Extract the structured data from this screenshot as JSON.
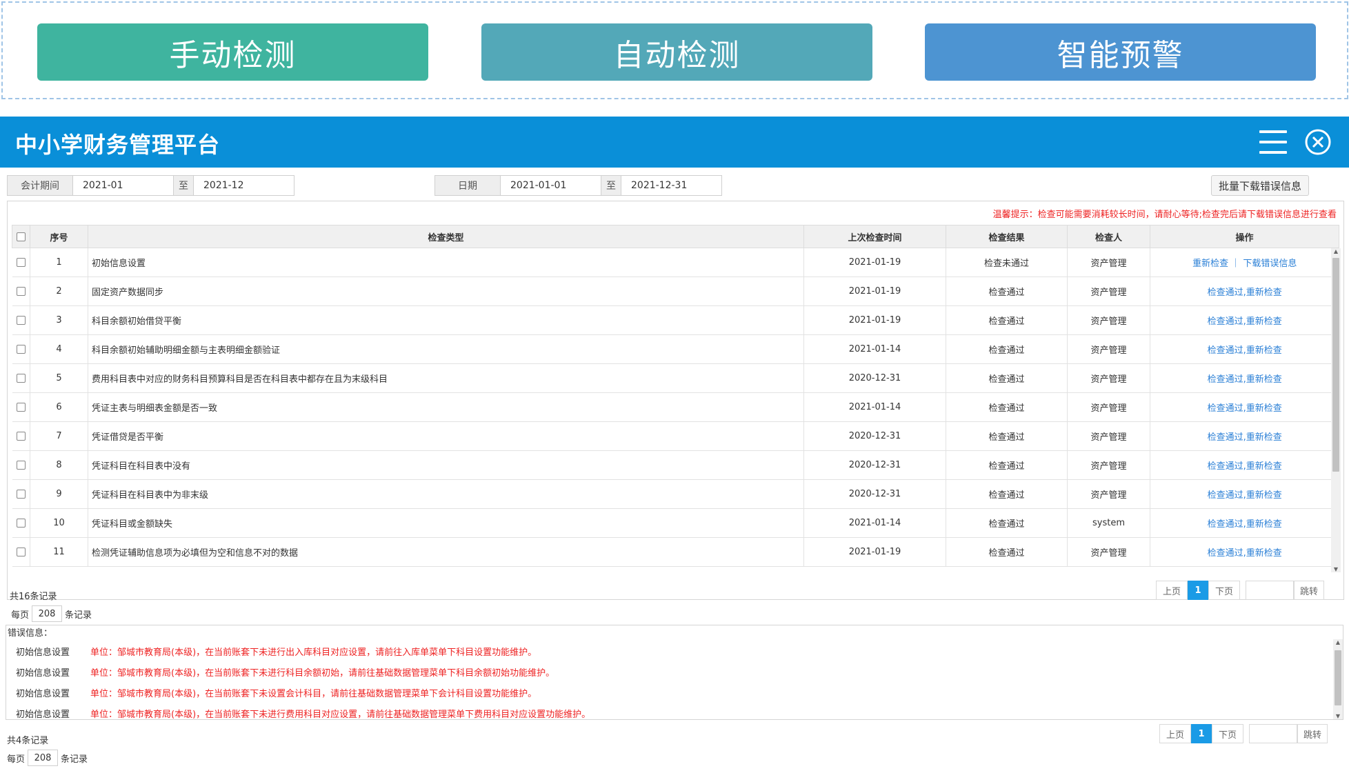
{
  "top_buttons": {
    "manual": "手动检测",
    "auto": "自动检测",
    "warning": "智能预警"
  },
  "header": {
    "title": "中小学财务管理平台"
  },
  "filters": {
    "period_label": "会计期间",
    "period_from": "2021-01",
    "period_sep": "至",
    "period_to": "2021-12",
    "date_label": "日期",
    "date_from": "2021-01-01",
    "date_sep": "至",
    "date_to": "2021-12-31",
    "batch_download": "批量下载错误信息"
  },
  "tip": "温馨提示：检查可能需要消耗较长时间，请耐心等待;检查完后请下载错误信息进行查看",
  "table": {
    "columns": [
      "序号",
      "检查类型",
      "上次检查时间",
      "检查结果",
      "检查人",
      "操作"
    ],
    "rows": [
      {
        "no": "1",
        "type": "初始信息设置",
        "time": "2021-01-19",
        "result": "检查未通过",
        "checker": "资产管理",
        "op": "重新检查 ｜ 下载错误信息"
      },
      {
        "no": "2",
        "type": "固定资产数据同步",
        "time": "2021-01-19",
        "result": "检查通过",
        "checker": "资产管理",
        "op": "检查通过,重新检查"
      },
      {
        "no": "3",
        "type": "科目余额初始借贷平衡",
        "time": "2021-01-19",
        "result": "检查通过",
        "checker": "资产管理",
        "op": "检查通过,重新检查"
      },
      {
        "no": "4",
        "type": "科目余额初始辅助明细金额与主表明细金额验证",
        "time": "2021-01-14",
        "result": "检查通过",
        "checker": "资产管理",
        "op": "检查通过,重新检查"
      },
      {
        "no": "5",
        "type": "费用科目表中对应的财务科目预算科目是否在科目表中都存在且为末级科目",
        "time": "2020-12-31",
        "result": "检查通过",
        "checker": "资产管理",
        "op": "检查通过,重新检查"
      },
      {
        "no": "6",
        "type": "凭证主表与明细表金额是否一致",
        "time": "2021-01-14",
        "result": "检查通过",
        "checker": "资产管理",
        "op": "检查通过,重新检查"
      },
      {
        "no": "7",
        "type": "凭证借贷是否平衡",
        "time": "2020-12-31",
        "result": "检查通过",
        "checker": "资产管理",
        "op": "检查通过,重新检查"
      },
      {
        "no": "8",
        "type": "凭证科目在科目表中没有",
        "time": "2020-12-31",
        "result": "检查通过",
        "checker": "资产管理",
        "op": "检查通过,重新检查"
      },
      {
        "no": "9",
        "type": "凭证科目在科目表中为非末级",
        "time": "2020-12-31",
        "result": "检查通过",
        "checker": "资产管理",
        "op": "检查通过,重新检查"
      },
      {
        "no": "10",
        "type": "凭证科目或金额缺失",
        "time": "2021-01-14",
        "result": "检查通过",
        "checker": "system",
        "op": "检查通过,重新检查"
      },
      {
        "no": "11",
        "type": "检测凭证辅助信息项为必填但为空和信息不对的数据",
        "time": "2021-01-19",
        "result": "检查通过",
        "checker": "资产管理",
        "op": "检查通过,重新检查"
      }
    ],
    "total": "共16条记录",
    "per_page_prefix": "每页",
    "per_page_value": "208",
    "per_page_suffix": "条记录"
  },
  "pager": {
    "prev": "上页",
    "current": "1",
    "next": "下页",
    "jump": "跳转"
  },
  "errors": {
    "title": "错误信息：",
    "rows": [
      {
        "category": "初始信息设置",
        "message": "单位：邹城市教育局(本级)，在当前账套下未进行出入库科目对应设置，请前往入库单菜单下科目设置功能维护。"
      },
      {
        "category": "初始信息设置",
        "message": "单位：邹城市教育局(本级)，在当前账套下未进行科目余额初始，请前往基础数据管理菜单下科目余额初始功能维护。"
      },
      {
        "category": "初始信息设置",
        "message": "单位：邹城市教育局(本级)，在当前账套下未设置会计科目，请前往基础数据管理菜单下会计科目设置功能维护。"
      },
      {
        "category": "初始信息设置",
        "message": "单位：邹城市教育局(本级)，在当前账套下未进行费用科目对应设置，请前往基础数据管理菜单下费用科目对应设置功能维护。"
      }
    ],
    "total": "共4条记录",
    "per_page_prefix": "每页",
    "per_page_value": "208",
    "per_page_suffix": "条记录"
  },
  "colors": {
    "header": "#0a8fd8",
    "manual": "#3fb49f",
    "auto": "#53a8b8",
    "warning": "#4d94d2",
    "link": "#2a7fd6",
    "error": "#ee2222"
  }
}
